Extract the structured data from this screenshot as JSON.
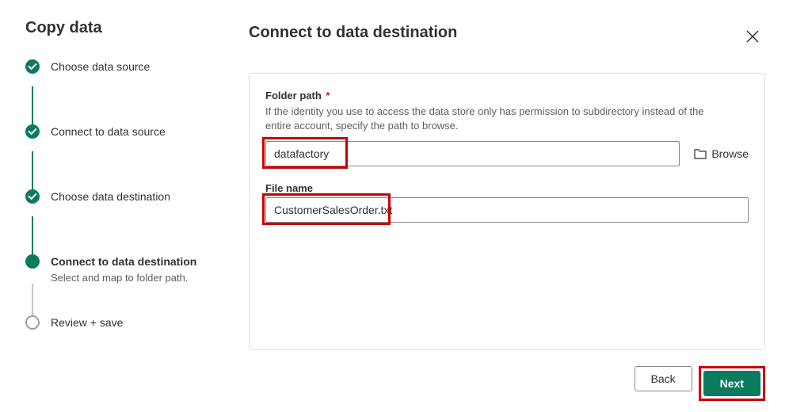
{
  "sidebar": {
    "title": "Copy data",
    "steps": [
      {
        "label": "Choose data source",
        "state": "done"
      },
      {
        "label": "Connect to data source",
        "state": "done"
      },
      {
        "label": "Choose data destination",
        "state": "done"
      },
      {
        "label": "Connect to data destination",
        "state": "active",
        "sub": "Select and map to folder path."
      },
      {
        "label": "Review + save",
        "state": "pending"
      }
    ]
  },
  "main": {
    "title": "Connect to data destination",
    "folder_path": {
      "label": "Folder path",
      "required_marker": "*",
      "desc": "If the identity you use to access the data store only has permission to subdirectory instead of the entire account, specify the path to browse.",
      "value": "datafactory",
      "browse_label": "Browse"
    },
    "file_name": {
      "label": "File name",
      "value": "CustomerSalesOrder.txt"
    }
  },
  "footer": {
    "back": "Back",
    "next": "Next"
  }
}
